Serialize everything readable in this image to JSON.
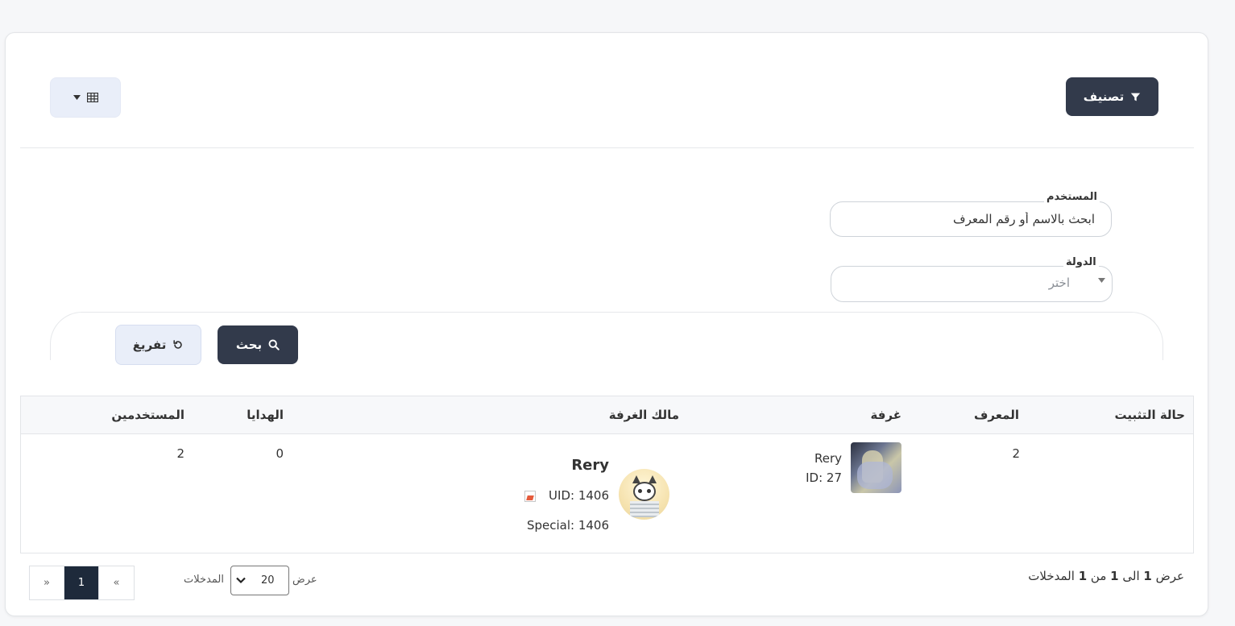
{
  "toolbar": {
    "filter_label": "تصنيف",
    "view_icon": "table-grid-icon"
  },
  "filters": {
    "user_label": "المستخدم",
    "user_placeholder": "ابحث بالاسم أو رقم المعرف",
    "country_label": "الدولة",
    "country_placeholder": "اختر",
    "search_label": "بحث",
    "reset_label": "تفريغ"
  },
  "table": {
    "headers": {
      "pin_status": "حالة التثبيت",
      "id": "المعرف",
      "room": "غرفة",
      "owner": "مالك الغرفة",
      "gifts": "الهدايا",
      "users": "المستخدمين"
    },
    "rows": [
      {
        "pin_status": "",
        "id": "2",
        "room_name": "Rery",
        "room_id": "ID: 27",
        "owner_name": "Rery",
        "owner_uid": "UID: 1406",
        "owner_special": "Special: 1406",
        "gifts": "0",
        "users": "2"
      }
    ]
  },
  "footer": {
    "prefix": "عرض",
    "from": "1",
    "mid1": "الى",
    "to": "1",
    "mid2": "من",
    "total": "1",
    "suffix": "المدخلات",
    "show_label": "عرض",
    "page_size": "20",
    "entries_label": "المدخلات",
    "prev": "«",
    "current_page": "1",
    "next": "»"
  },
  "colors": {
    "dark_button": "#323a4b",
    "light_button": "#e9eef9",
    "active_page": "#1e2a3b"
  }
}
